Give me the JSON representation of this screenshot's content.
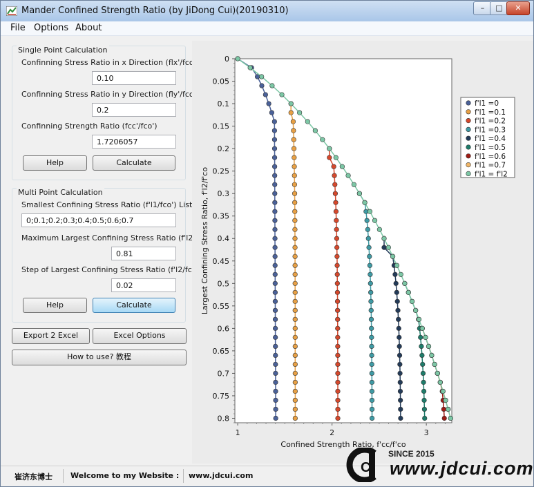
{
  "window": {
    "title": "Mander Confined Strength Ratio (by JiDong Cui)(20190310)",
    "min_glyph": "–",
    "max_glyph": "□",
    "close_glyph": "✕"
  },
  "menu": {
    "items": [
      "File",
      "Options",
      "About"
    ]
  },
  "single": {
    "title": "Single Point Calculation",
    "flx_label": "Confinning Stress Ratio in x Direction (flx'/fco')",
    "flx_value": "0.10",
    "fly_label": "Confinning Stress Ratio in y Direction (fly'/fco')",
    "fly_value": "0.2",
    "fcc_label": "Confinning Strength Ratio (fcc'/fco')",
    "fcc_value": "1.7206057",
    "help_label": "Help",
    "calc_label": "Calculate"
  },
  "multi": {
    "title": "Multi Point Calculation",
    "list_label": "Smallest Confining Stress Ratio (f'l1/fco') List",
    "list_value": "0;0.1;0.2;0.3;0.4;0.5;0.6;0.7",
    "max_label": "Maximum Largest Confining Stress Ratio (f'l2/fco')",
    "max_value": "0.81",
    "step_label": "Step of Largest Confining Stress Ratio (f'l2/fco')",
    "step_value": "0.02",
    "help_label": "Help",
    "calc_label": "Calculate"
  },
  "actions": {
    "export_label": "Export 2 Excel",
    "excel_options_label": "Excel Options",
    "howto_label": "How to use? 教程"
  },
  "status": {
    "author": "崔济东博士",
    "welcome": "Welcome to my Website :",
    "site": "www.jdcui.com"
  },
  "logo": {
    "since": "SINCE 2015",
    "url": "www.jdcui.com",
    "mark": "C"
  },
  "chart_data": {
    "type": "scatter",
    "xlabel": "Confined Strength Ratio, f'cc/f'co",
    "ylabel": "Largest Confining Stress Ratio, f'l2/f'co",
    "xlim": [
      0.97,
      3.27
    ],
    "ylim": [
      0,
      0.81
    ],
    "y_inverted": true,
    "x_ticks": [
      1,
      2,
      3
    ],
    "y_ticks": [
      0,
      0.05,
      0.1,
      0.15,
      0.2,
      0.25,
      0.3,
      0.35,
      0.4,
      0.45,
      0.5,
      0.55,
      0.6,
      0.65,
      0.7,
      0.75,
      0.8
    ],
    "grid": false,
    "legend_position": "right",
    "series": [
      {
        "name": "f'l1 =0",
        "color": "#4a6199",
        "l1": 0
      },
      {
        "name": "f'l1 =0.1",
        "color": "#e8a044",
        "l1": 0.1
      },
      {
        "name": "f'l1 =0.2",
        "color": "#d6482c",
        "l1": 0.2
      },
      {
        "name": "f'l1 =0.3",
        "color": "#3e9aa4",
        "l1": 0.3
      },
      {
        "name": "f'l1 =0.4",
        "color": "#233b59",
        "l1": 0.4
      },
      {
        "name": "f'l1 =0.5",
        "color": "#1e7c6a",
        "l1": 0.5
      },
      {
        "name": "f'l1 =0.6",
        "color": "#9e1b14",
        "l1": 0.6
      },
      {
        "name": "f'l1 =0.7",
        "color": "#f0b668",
        "l1": 0.7
      },
      {
        "name": "f'l1 = f'l2",
        "color": "#7cc7a5",
        "l1": "equal"
      }
    ]
  }
}
